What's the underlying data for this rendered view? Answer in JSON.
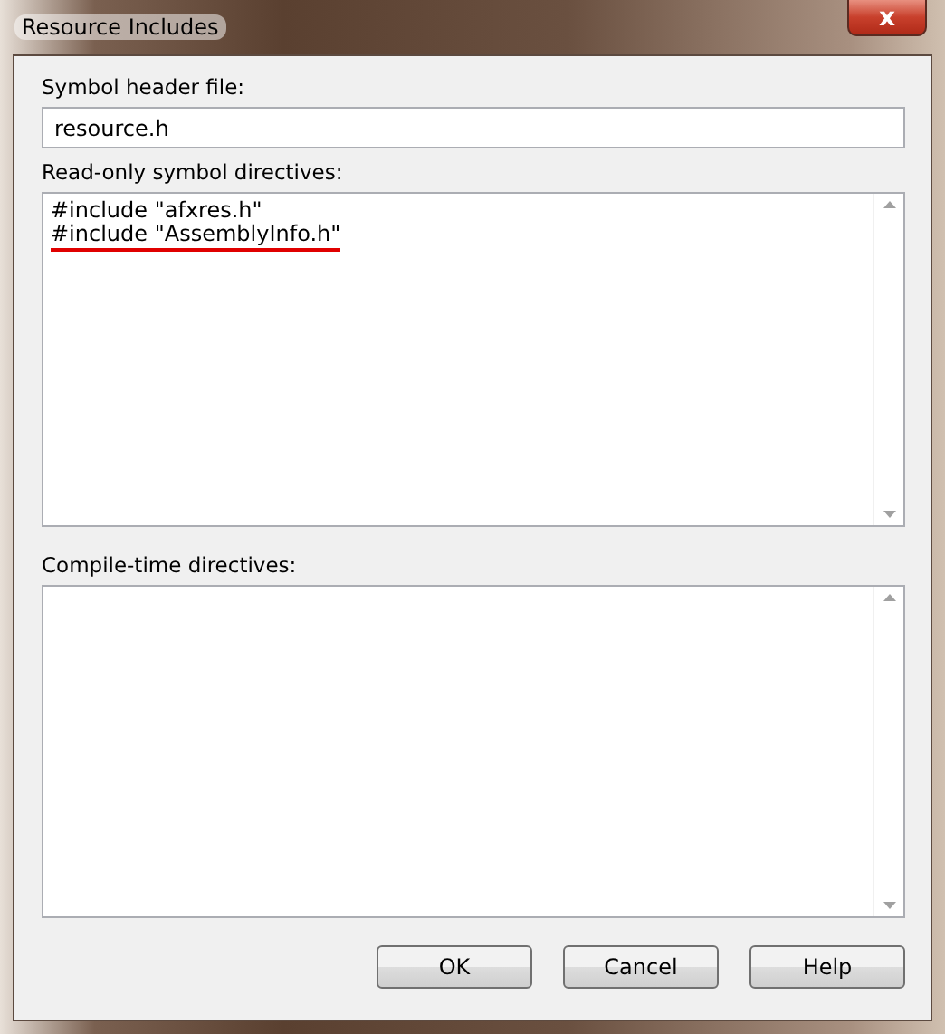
{
  "window": {
    "title": "Resource Includes",
    "close": "x"
  },
  "symbol_header": {
    "label": "Symbol header file:",
    "value": "resource.h"
  },
  "read_only_directives": {
    "label": "Read-only symbol directives:",
    "lines": [
      {
        "text": "#include \"afxres.h\"",
        "underlined": false
      },
      {
        "text": "#include \"AssemblyInfo.h\"",
        "underlined": true
      }
    ]
  },
  "compile_time_directives": {
    "label": "Compile-time directives:"
  },
  "buttons": [
    "OK",
    "Cancel",
    "Help"
  ]
}
